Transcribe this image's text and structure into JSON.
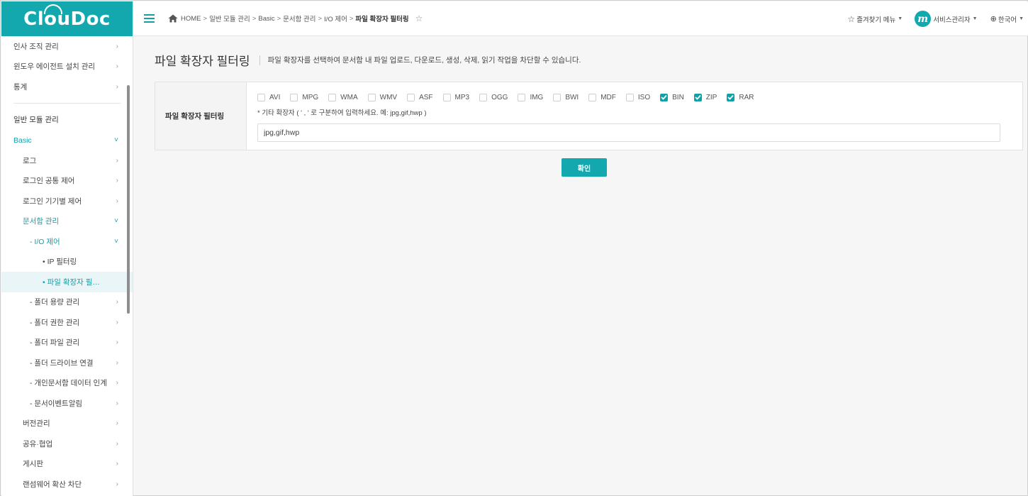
{
  "app": {
    "logo_text": "ClouDoc"
  },
  "colors": {
    "accent": "#12a8ad",
    "active_bg": "#e9f5f6"
  },
  "sidebar": {
    "top_items": [
      {
        "label": "인사 조직 관리"
      },
      {
        "label": "윈도우 에이전트 설치 관리"
      },
      {
        "label": "통계"
      }
    ],
    "section_title": "일반 모듈 관리",
    "tree": [
      {
        "label": "Basic",
        "level": 1,
        "expanded": true
      },
      {
        "label": "로그",
        "level": 2
      },
      {
        "label": "로그인 공통 제어",
        "level": 2
      },
      {
        "label": "로그인 기기별 제어",
        "level": 2
      },
      {
        "label": "문서함 관리",
        "level": 2,
        "expanded": true
      },
      {
        "label": "- I/O 제어",
        "level": 3,
        "expanded": true
      },
      {
        "label": "• IP 필터링",
        "level": 4
      },
      {
        "label": "• 파일 확장자 필…",
        "level": 4,
        "active": true
      },
      {
        "label": "- 폴더 용량 관리",
        "level": 3
      },
      {
        "label": "- 폴더 권한 관리",
        "level": 3
      },
      {
        "label": "- 폴더 파일 관리",
        "level": 3
      },
      {
        "label": "- 폴더 드라이브 연결",
        "level": 3
      },
      {
        "label": "- 개인문서함 데이터 인계",
        "level": 3
      },
      {
        "label": "- 문서이벤트알림",
        "level": 3
      },
      {
        "label": "버전관리",
        "level": 2
      },
      {
        "label": "공유·협업",
        "level": 2
      },
      {
        "label": "게시판",
        "level": 2
      },
      {
        "label": "랜섬웨어 확산 차단",
        "level": 2
      }
    ]
  },
  "topbar": {
    "breadcrumb": [
      "HOME",
      "일반 모듈 관리",
      "Basic",
      "문서함 관리",
      "I/O 제어"
    ],
    "breadcrumb_current": "파일 확장자 필터링",
    "breadcrumb_sep": ">",
    "favorites_label": "즐겨찾기 메뉴",
    "user_initial": "m",
    "user_name": "서비스관리자",
    "language": "한국어"
  },
  "page": {
    "title": "파일 확장자 필터링",
    "description": "파일 확장자를 선택하여 문서함 내 파일 업로드, 다운로드, 생성, 삭제, 읽기 작업을 차단할 수 있습니다."
  },
  "filter": {
    "label": "파일 확장자 필터링",
    "extensions": [
      {
        "name": "AVI",
        "checked": false
      },
      {
        "name": "MPG",
        "checked": false
      },
      {
        "name": "WMA",
        "checked": false
      },
      {
        "name": "WMV",
        "checked": false
      },
      {
        "name": "ASF",
        "checked": false
      },
      {
        "name": "MP3",
        "checked": false
      },
      {
        "name": "OGG",
        "checked": false
      },
      {
        "name": "IMG",
        "checked": false
      },
      {
        "name": "BWI",
        "checked": false
      },
      {
        "name": "MDF",
        "checked": false
      },
      {
        "name": "ISO",
        "checked": false
      },
      {
        "name": "BIN",
        "checked": true
      },
      {
        "name": "ZIP",
        "checked": true
      },
      {
        "name": "RAR",
        "checked": true
      }
    ],
    "hint": "* 기타 확장자 ( ' , ' 로 구분하여 입력하세요. 예: jpg,gif,hwp )",
    "input_value": "jpg,gif,hwp"
  },
  "actions": {
    "confirm_label": "확인"
  }
}
